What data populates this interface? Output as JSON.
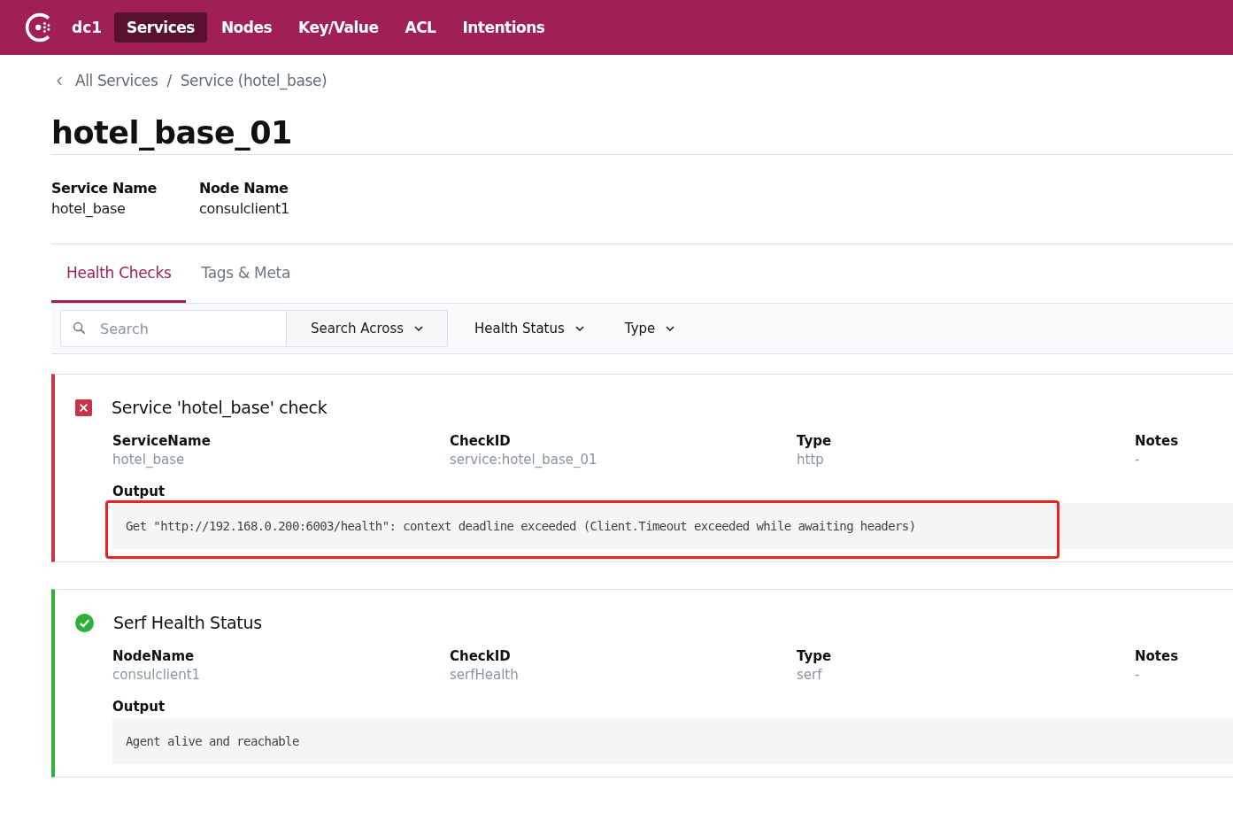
{
  "nav": {
    "datacenter": "dc1",
    "items": [
      {
        "label": "Services",
        "selected": true
      },
      {
        "label": "Nodes",
        "selected": false
      },
      {
        "label": "Key/Value",
        "selected": false
      },
      {
        "label": "ACL",
        "selected": false
      },
      {
        "label": "Intentions",
        "selected": false
      }
    ]
  },
  "breadcrumbs": [
    "All Services",
    "Service (hotel_base)"
  ],
  "breadcrumb_separator": "/",
  "title": "hotel_base_01",
  "details": [
    {
      "label": "Service Name",
      "value": "hotel_base"
    },
    {
      "label": "Node Name",
      "value": "consulclient1"
    }
  ],
  "tabs": [
    {
      "label": "Health Checks",
      "selected": true
    },
    {
      "label": "Tags & Meta",
      "selected": false
    }
  ],
  "filter_bar": {
    "search": {
      "placeholder": "Search"
    },
    "search_across": "Search Across",
    "filters": [
      "Health Status",
      "Type"
    ]
  },
  "checks": [
    {
      "kind": "critical",
      "title": "Service 'hotel_base' check",
      "fields": [
        {
          "label": "ServiceName",
          "value": "hotel_base"
        },
        {
          "label": "CheckID",
          "value": "service:hotel_base_01"
        },
        {
          "label": "Type",
          "value": "http"
        },
        {
          "label": "Notes",
          "value": "-"
        }
      ],
      "output_label": "Output",
      "output": "Get \"http://192.168.0.200:6003/health\": context deadline exceeded (Client.Timeout exceeded while awaiting headers)",
      "highlighted": true
    },
    {
      "kind": "passing",
      "title": "Serf Health Status",
      "fields": [
        {
          "label": "NodeName",
          "value": "consulclient1"
        },
        {
          "label": "CheckID",
          "value": "serfHealth"
        },
        {
          "label": "Type",
          "value": "serf"
        },
        {
          "label": "Notes",
          "value": "-"
        }
      ],
      "output_label": "Output",
      "output": "Agent alive and reachable",
      "highlighted": false
    }
  ]
}
